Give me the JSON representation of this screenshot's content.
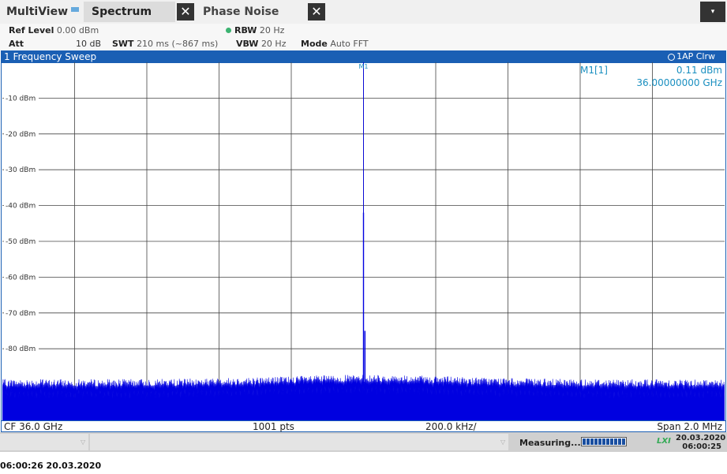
{
  "tabs": {
    "multiview": "MultiView",
    "spectrum": "Spectrum",
    "phase_noise": "Phase Noise",
    "close_glyph": "✕",
    "menu_glyph": "▾"
  },
  "settings": {
    "ref_level_label": "Ref Level",
    "ref_level_value": "0.00 dBm",
    "att_label": "Att",
    "att_value": "10 dB",
    "swt_label": "SWT",
    "swt_value": "210 ms (~867 ms)",
    "rbw_label": "RBW",
    "rbw_value": "20 Hz",
    "vbw_label": "VBW",
    "vbw_value": "20 Hz",
    "mode_label": "Mode",
    "mode_value": "Auto FFT"
  },
  "window": {
    "title": "1 Frequency Sweep",
    "trace_mode": "1AP Clrw"
  },
  "marker": {
    "label": "M1",
    "info_label": "M1[1]",
    "level": "0.11 dBm",
    "frequency": "36.00000000 GHz"
  },
  "bottom": {
    "cf": "CF 36.0 GHz",
    "points": "1001 pts",
    "div": "200.0 kHz/",
    "span": "Span 2.0 MHz"
  },
  "status": {
    "measuring": "Measuring...",
    "date": "20.03.2020",
    "time": "06:00:25",
    "progress": 1.0
  },
  "footer": {
    "stamp": "06:00:26  20.03.2020"
  },
  "colors": {
    "trace": "#0000e0",
    "accent": "#1a5fb4",
    "marker": "#1a8fc0",
    "grid": "#444444"
  },
  "chart_data": {
    "type": "line",
    "x_unit": "MHz offset from CF",
    "xlim": [
      -1.0,
      1.0
    ],
    "ylim": [
      -100,
      0
    ],
    "y_ticks": [
      -10,
      -20,
      -30,
      -40,
      -50,
      -60,
      -70,
      -80
    ],
    "y_tick_labels": [
      "-10 dBm",
      "-20 dBm",
      "-30 dBm",
      "-40 dBm",
      "-50 dBm",
      "-60 dBm",
      "-70 dBm",
      "-80 dBm"
    ],
    "noise_floor_dbm": -90.5,
    "noise_floor_variation_db": 2,
    "peak": {
      "x": 0.0,
      "y": 0.11
    },
    "spikes": [
      {
        "x": 0.0,
        "y": -42
      },
      {
        "x": 0.004,
        "y": -75
      }
    ],
    "grid": true
  }
}
